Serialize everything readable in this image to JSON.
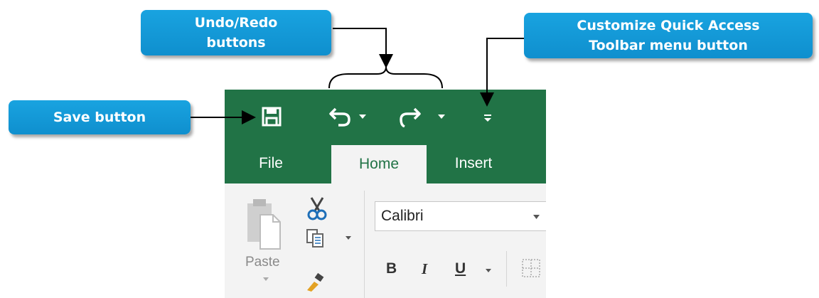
{
  "callouts": {
    "undo_redo": {
      "line1": "Undo/Redo",
      "line2": "buttons"
    },
    "customize": {
      "line1": "Customize Quick Access",
      "line2": "Toolbar menu button"
    },
    "save": "Save button"
  },
  "tabs": [
    {
      "label": "File"
    },
    {
      "label": "Home"
    },
    {
      "label": "Insert"
    }
  ],
  "ribbon": {
    "paste_label": "Paste",
    "font_name": "Calibri",
    "bold": "B",
    "italic": "I",
    "underline": "U"
  },
  "colors": {
    "excel_green": "#217346",
    "callout_blue": "#149bd7",
    "ribbon_bg": "#f3f3f3"
  },
  "icons": [
    "save-icon",
    "undo-icon",
    "redo-icon",
    "customize-qat-icon",
    "clipboard-icon",
    "cut-icon",
    "copy-icon",
    "format-painter-icon",
    "borders-icon"
  ]
}
